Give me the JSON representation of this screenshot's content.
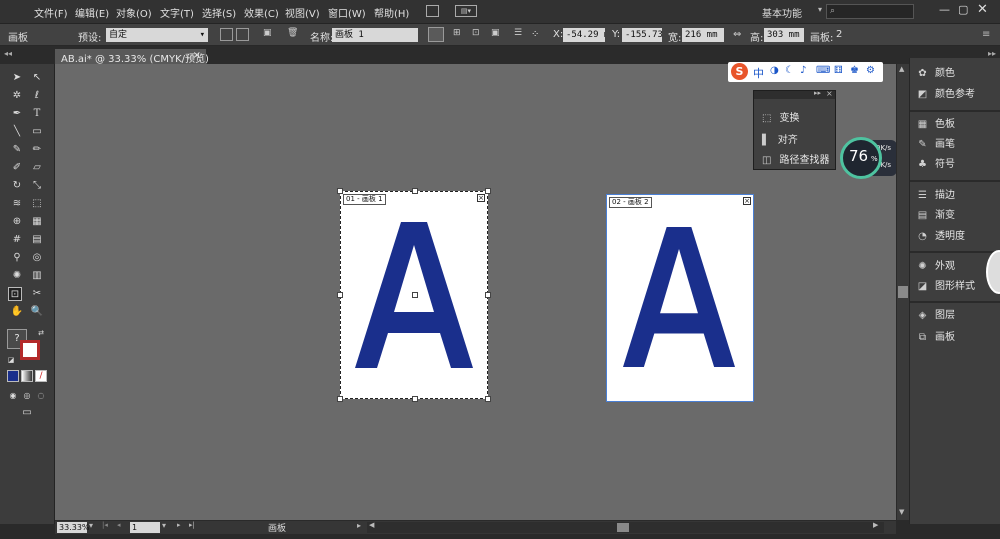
{
  "menubar": {
    "items": [
      "文件(F)",
      "编辑(E)",
      "对象(O)",
      "文字(T)",
      "选择(S)",
      "效果(C)",
      "视图(V)",
      "窗口(W)",
      "帮助(H)"
    ],
    "workspace": "基本功能"
  },
  "control": {
    "panel_name": "画板",
    "preset_label": "预设:",
    "preset_value": "自定",
    "name_label": "名称:",
    "name_value": "画板 1",
    "x_label": "X:",
    "x_value": "-54.29 m",
    "y_label": "Y:",
    "y_value": "-155.73",
    "width_label": "宽:",
    "width_value": "216 mm",
    "height_label": "高:",
    "height_value": "303 mm",
    "artboards_label": "画板:",
    "artboards_value": "2"
  },
  "document": {
    "tab_title": "AB.ai* @ 33.33% (CMYK/预览)",
    "close_glyph": "×"
  },
  "artboards": [
    {
      "label": "01 - 画板 1",
      "letter": "A",
      "selected": true
    },
    {
      "label": "02 - 画板 2",
      "letter": "A",
      "selected": false
    }
  ],
  "colors": {
    "letter": "#1a2f8c",
    "canvas": "#6a6a6a",
    "accent": "#4a7fd4"
  },
  "floating_panel": {
    "items": [
      "变换",
      "对齐",
      "路径查找器"
    ]
  },
  "network_widget": {
    "percent": "76",
    "unit": "%",
    "upload": "0K/s",
    "download": "0K/s"
  },
  "right_panel": {
    "groups": [
      [
        "颜色",
        "颜色参考"
      ],
      [
        "色板",
        "画笔",
        "符号"
      ],
      [
        "描边",
        "渐变",
        "透明度"
      ],
      [
        "外观",
        "图形样式"
      ],
      [
        "图层",
        "画板"
      ]
    ]
  },
  "statusbar": {
    "zoom": "33.33%",
    "page": "1",
    "status_text": "画板"
  },
  "ime": {
    "logo": "S",
    "mode": "中"
  }
}
